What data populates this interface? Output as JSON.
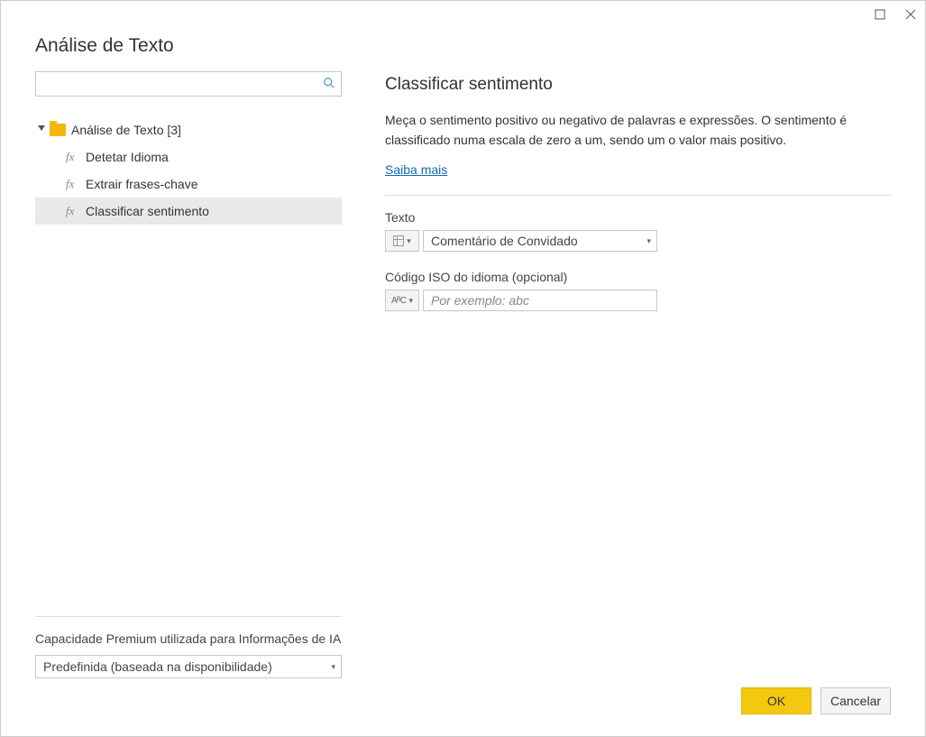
{
  "titlebar": {
    "maximize_glyph": "☐",
    "close_glyph": "✕"
  },
  "dialog": {
    "title": "Análise de Texto"
  },
  "search": {
    "value": "",
    "placeholder": ""
  },
  "tree": {
    "root": "Análise de Texto [3]",
    "items": [
      {
        "label": "Detetar Idioma"
      },
      {
        "label": "Extrair frases-chave"
      },
      {
        "label": "Classificar sentimento"
      }
    ]
  },
  "capacity": {
    "label": "Capacidade Premium utilizada para Informações de IA",
    "value": "Predefinida (baseada na disponibilidade)"
  },
  "detail": {
    "title": "Classificar sentimento",
    "description": "Meça o sentimento positivo ou negativo de palavras e expressões. O sentimento é classificado numa escala de zero a um, sendo um o valor mais positivo.",
    "learn_more": "Saiba mais"
  },
  "fields": {
    "text": {
      "label": "Texto",
      "value": "Comentário de Convidado"
    },
    "iso": {
      "label": "Código ISO do idioma (opcional)",
      "placeholder": "Por exemplo: abc",
      "value": ""
    }
  },
  "buttons": {
    "ok": "OK",
    "cancel": "Cancelar"
  },
  "glyphs": {
    "fx": "fx",
    "chevron_down": "▾",
    "caret": "▾",
    "search": "⌕",
    "abc": "AᴮC"
  }
}
